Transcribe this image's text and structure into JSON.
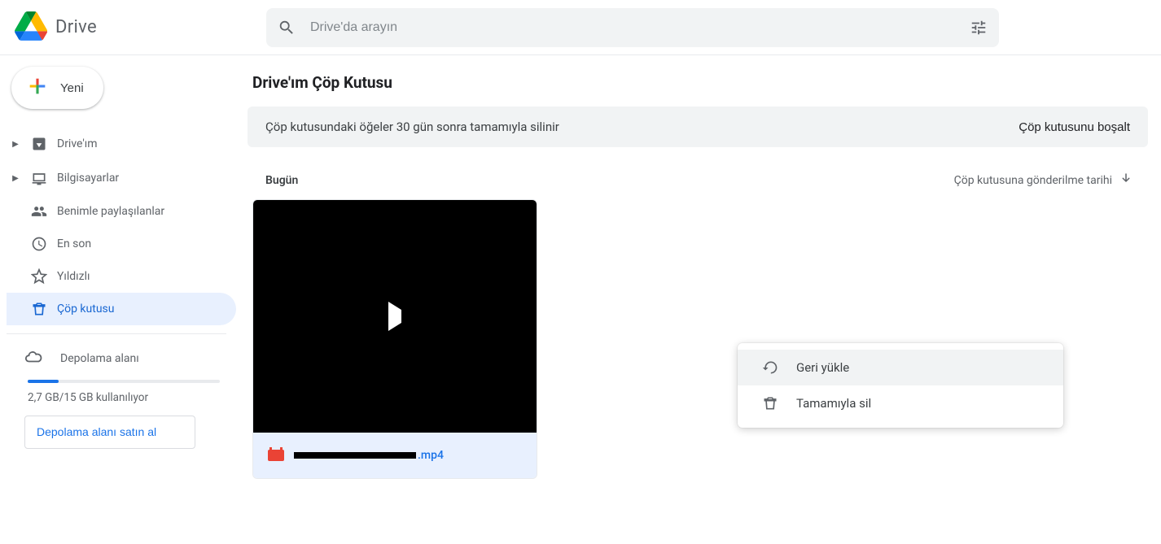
{
  "header": {
    "app_name": "Drive",
    "search_placeholder": "Drive'da arayın"
  },
  "sidebar": {
    "new_label": "Yeni",
    "items": {
      "my_drive": "Drive'ım",
      "computers": "Bilgisayarlar",
      "shared": "Benimle paylaşılanlar",
      "recent": "En son",
      "starred": "Yıldızlı",
      "trash": "Çöp kutusu"
    },
    "storage_label": "Depolama alanı",
    "storage_usage": "2,7 GB/15 GB kullanılıyor",
    "buy_storage": "Depolama alanı satın al"
  },
  "main": {
    "title": "Drive'ım Çöp Kutusu",
    "banner_msg": "Çöp kutusundaki öğeler 30 gün sonra tamamıyla silinir",
    "banner_action": "Çöp kutusunu boşalt",
    "section_label": "Bugün",
    "sort_label": "Çöp kutusuna gönderilme tarihi",
    "file_ext": ".mp4"
  },
  "context_menu": {
    "restore": "Geri yükle",
    "delete_forever": "Tamamıyla sil"
  }
}
